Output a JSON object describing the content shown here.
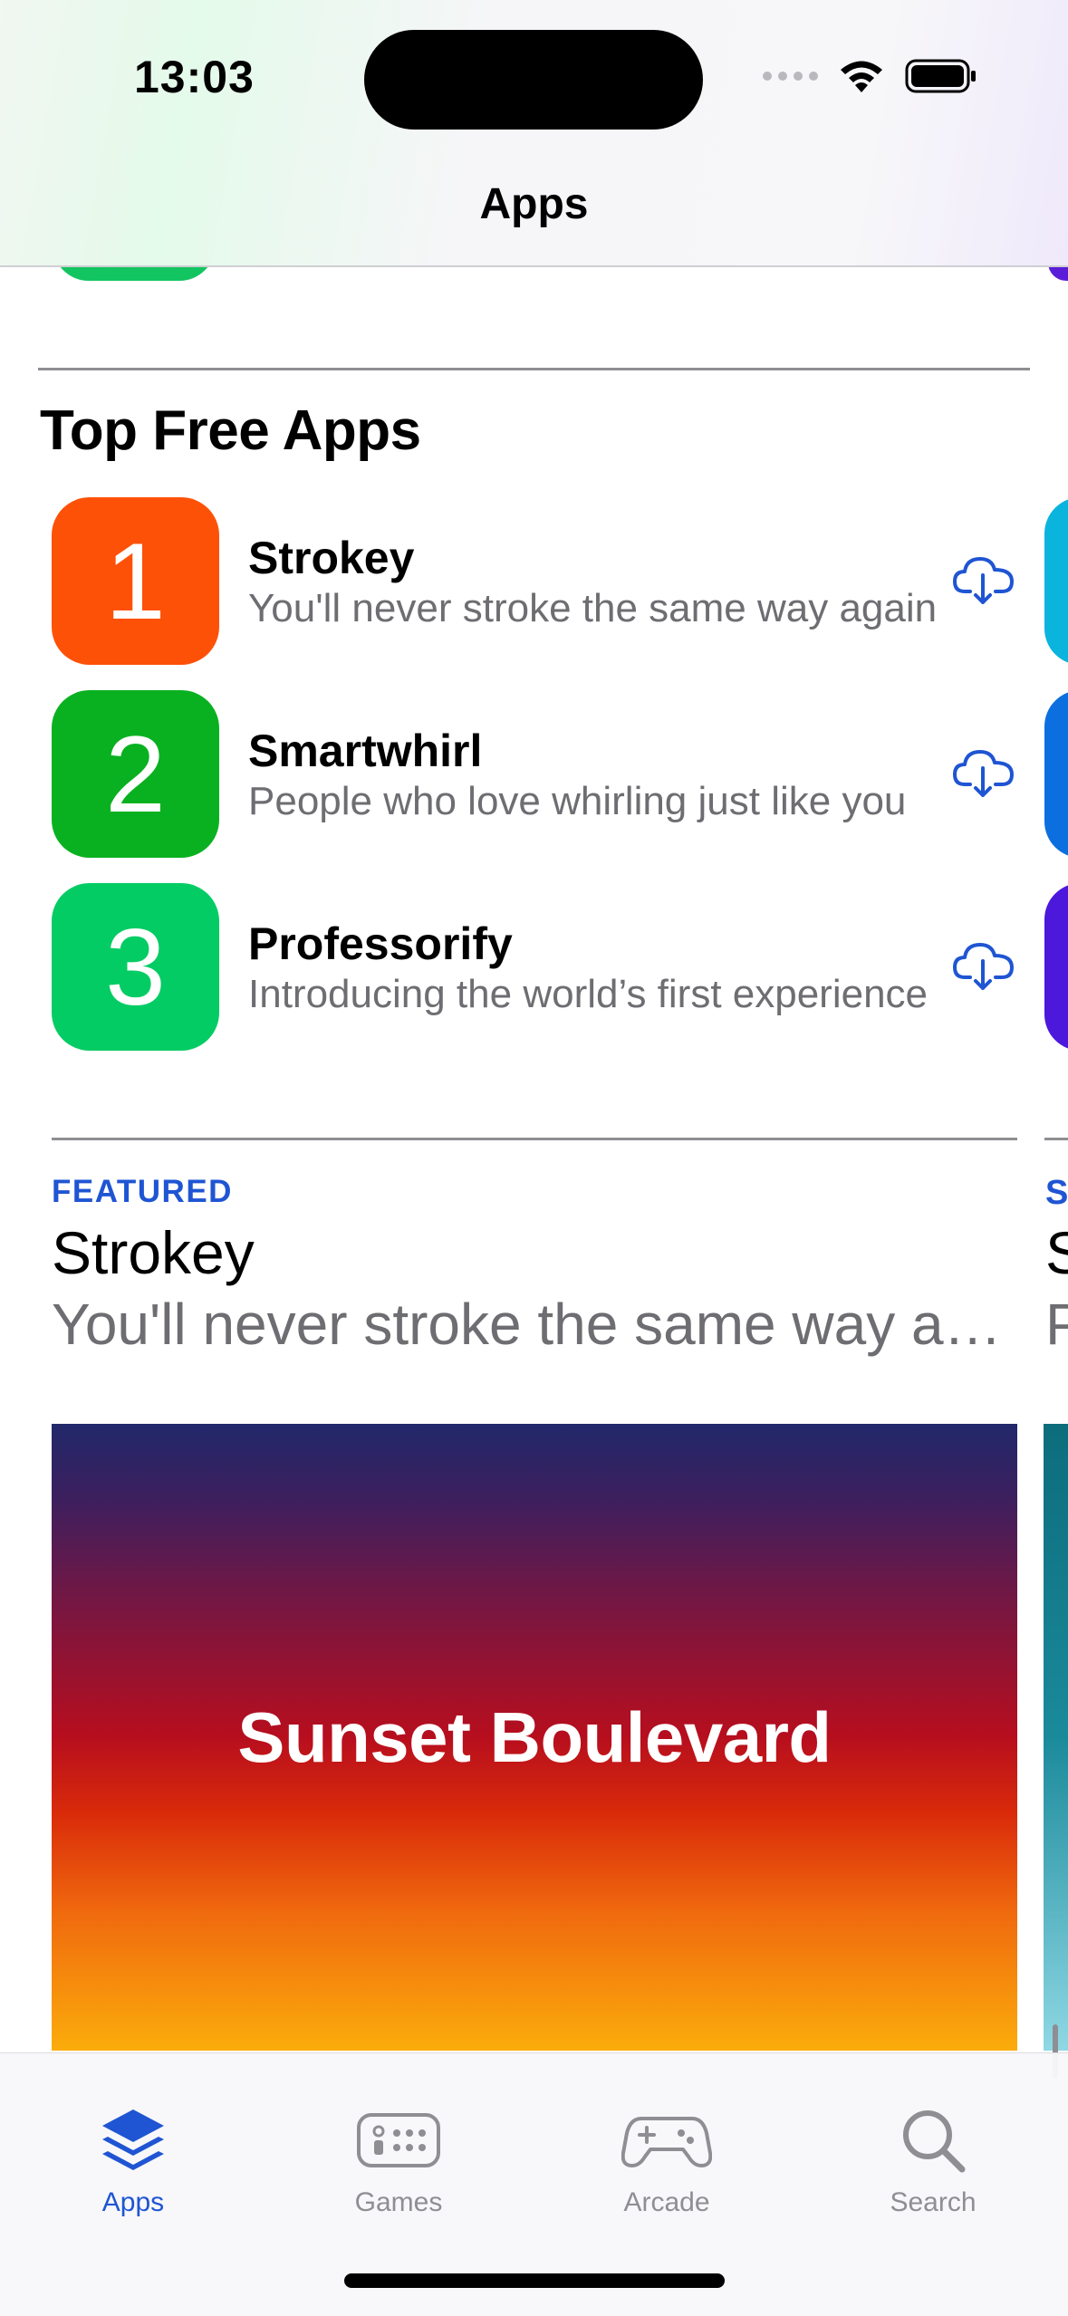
{
  "status_bar": {
    "time": "13:03"
  },
  "nav": {
    "title": "Apps"
  },
  "top_free": {
    "title": "Top Free Apps",
    "apps": [
      {
        "rank": "1",
        "name": "Strokey",
        "subtitle": "You'll never stroke the same way again",
        "color": "#fe5108"
      },
      {
        "rank": "2",
        "name": "Smartwhirl",
        "subtitle": "People who love whirling just like you",
        "color": "#09b120"
      },
      {
        "rank": "3",
        "name": "Professorify",
        "subtitle": "Introducing the world’s first experience",
        "color": "#04cc64"
      }
    ]
  },
  "featured": {
    "label": "FEATURED",
    "title": "Strokey",
    "subtitle": "You'll never stroke the same way again",
    "banner_text": "Sunset Boulevard",
    "peek_label": "S",
    "peek_title": "S",
    "peek_sub": "P"
  },
  "tabs": [
    {
      "label": "Apps",
      "icon": "apps-stack-icon",
      "active": true
    },
    {
      "label": "Games",
      "icon": "games-icon",
      "active": false
    },
    {
      "label": "Arcade",
      "icon": "arcade-controller-icon",
      "active": false
    },
    {
      "label": "Search",
      "icon": "search-icon",
      "active": false
    }
  ],
  "colors": {
    "accent": "#1f55d3",
    "secondary_text": "#6d6d72"
  }
}
